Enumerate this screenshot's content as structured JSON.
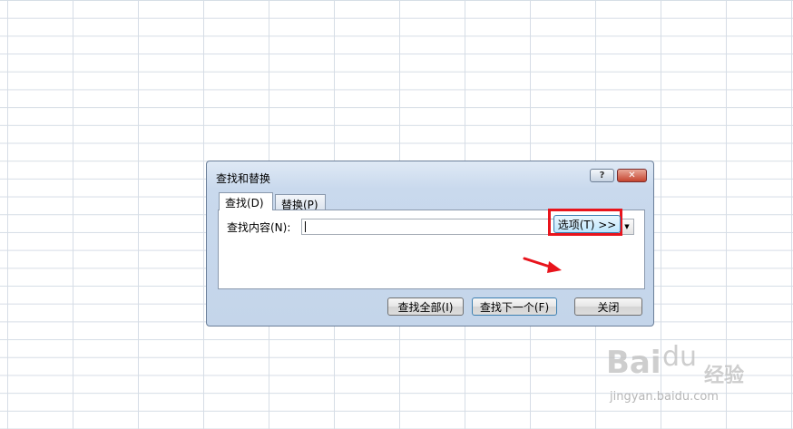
{
  "dialog": {
    "title": "查找和替换",
    "help_symbol": "?",
    "close_symbol": "✕",
    "tabs": [
      {
        "label": "查找(D)",
        "active": true
      },
      {
        "label": "替换(P)",
        "active": false
      }
    ],
    "find_label": "查找内容(N):",
    "find_value": "",
    "dropdown_symbol": "▼",
    "options_button": "选项(T) >>",
    "buttons": {
      "find_all": "查找全部(I)",
      "find_next": "查找下一个(F)",
      "close": "关闭"
    }
  },
  "annotation": {
    "highlight_color": "#e8141c"
  },
  "watermark": {
    "logo": "Bai",
    "logo_mark": "du",
    "name": "经验",
    "url": "jingyan.baidu.com"
  }
}
